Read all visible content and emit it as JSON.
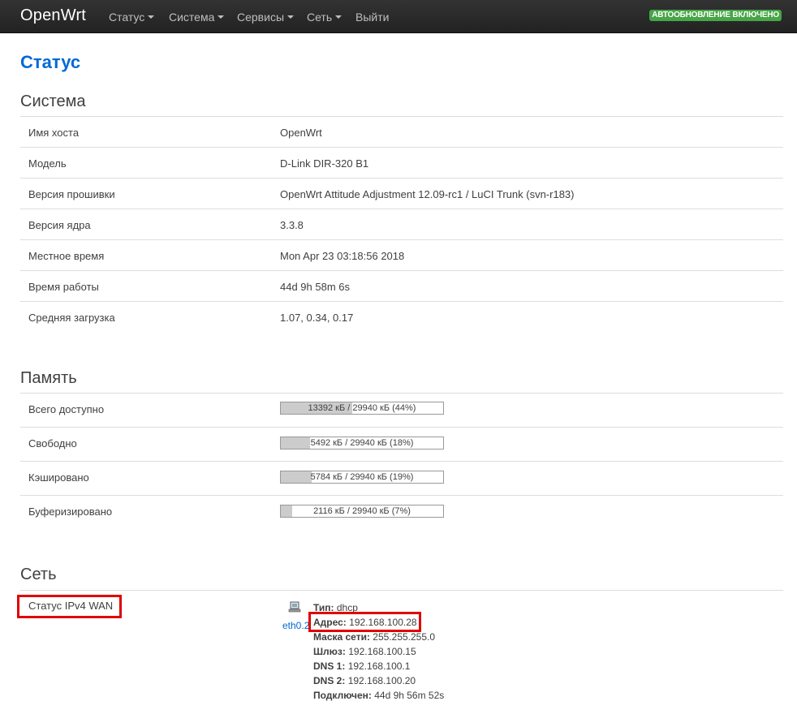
{
  "nav": {
    "brand": "OpenWrt",
    "items": [
      "Статус",
      "Система",
      "Сервисы",
      "Сеть",
      "Выйти"
    ],
    "badge": "АВТООБНОВЛЕНИЕ ВКЛЮЧЕНО"
  },
  "page_title": "Статус",
  "system": {
    "title": "Система",
    "rows": [
      {
        "label": "Имя хоста",
        "value": "OpenWrt"
      },
      {
        "label": "Модель",
        "value": "D-Link DIR-320 B1"
      },
      {
        "label": "Версия прошивки",
        "value": "OpenWrt Attitude Adjustment 12.09-rc1 / LuCI Trunk (svn-r183)"
      },
      {
        "label": "Версия ядра",
        "value": "3.3.8"
      },
      {
        "label": "Местное время",
        "value": "Mon Apr 23 03:18:56 2018"
      },
      {
        "label": "Время работы",
        "value": "44d 9h 58m 6s"
      },
      {
        "label": "Средняя загрузка",
        "value": "1.07, 0.34, 0.17"
      }
    ]
  },
  "memory": {
    "title": "Память",
    "rows": [
      {
        "label": "Всего доступно",
        "text": "13392 кБ / 29940 кБ (44%)",
        "fraction": 0.44
      },
      {
        "label": "Свободно",
        "text": "5492 кБ / 29940 кБ (18%)",
        "fraction": 0.18
      },
      {
        "label": "Кэшировано",
        "text": "5784 кБ / 29940 кБ (19%)",
        "fraction": 0.19
      },
      {
        "label": "Буферизировано",
        "text": "2116 кБ / 29940 кБ (7%)",
        "fraction": 0.07
      }
    ]
  },
  "network": {
    "title": "Сеть",
    "wan_label": "Статус IPv4 WAN",
    "interface": "eth0.2",
    "details": [
      {
        "key": "Тип:",
        "value": "dhcp"
      },
      {
        "key": "Адрес:",
        "value": "192.168.100.28"
      },
      {
        "key": "Маска сети:",
        "value": "255.255.255.0"
      },
      {
        "key": "Шлюз:",
        "value": "192.168.100.15"
      },
      {
        "key": "DNS 1:",
        "value": "192.168.100.1"
      },
      {
        "key": "DNS 2:",
        "value": "192.168.100.20"
      },
      {
        "key": "Подключен:",
        "value": "44d 9h 56m 52s"
      }
    ]
  },
  "colors": {
    "accent": "#0069d6",
    "badge": "#46a546",
    "highlight": "#e00000"
  }
}
